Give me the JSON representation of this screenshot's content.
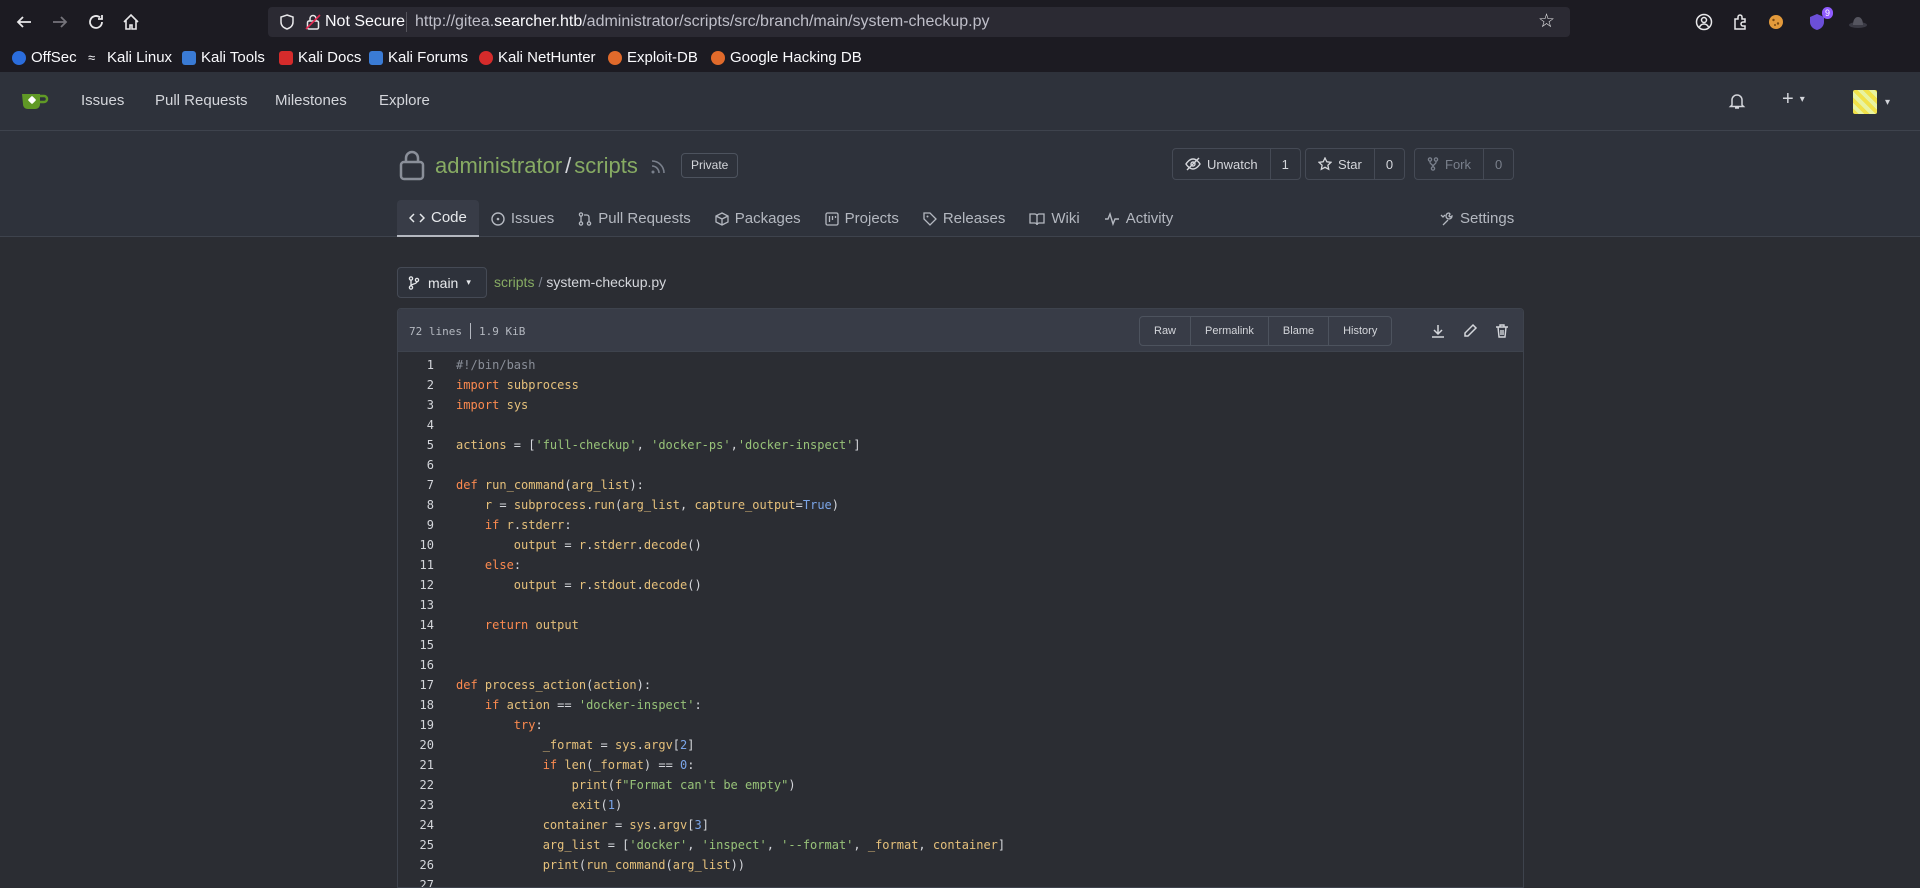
{
  "browser": {
    "url_security": "Not Secure",
    "url_prefix": "http://gitea.",
    "url_host": "searcher.htb",
    "url_path": "/administrator/scripts/src/branch/main/system-checkup.py",
    "extension_badge": "9",
    "bookmarks": [
      {
        "label": "OffSec",
        "color": "#2b6ddc"
      },
      {
        "label": "Kali Linux",
        "color": "#1c1b22"
      },
      {
        "label": "Kali Tools",
        "color": "#3a7bd5"
      },
      {
        "label": "Kali Docs",
        "color": "#d52b2b"
      },
      {
        "label": "Kali Forums",
        "color": "#3a7bd5"
      },
      {
        "label": "Kali NetHunter",
        "color": "#d52b2b"
      },
      {
        "label": "Exploit-DB",
        "color": "#e06a2b"
      },
      {
        "label": "Google Hacking DB",
        "color": "#e06a2b"
      }
    ]
  },
  "gitea": {
    "nav": [
      "Issues",
      "Pull Requests",
      "Milestones",
      "Explore"
    ],
    "repo": {
      "owner": "administrator",
      "name": "scripts",
      "visibility": "Private",
      "watch_label": "Unwatch",
      "watch_count": "1",
      "star_label": "Star",
      "star_count": "0",
      "fork_label": "Fork",
      "fork_count": "0"
    },
    "tabs": [
      "Code",
      "Issues",
      "Pull Requests",
      "Packages",
      "Projects",
      "Releases",
      "Wiki",
      "Activity"
    ],
    "settings_label": "Settings",
    "branch": "main",
    "breadcrumb_repo": "scripts",
    "breadcrumb_file": "system-checkup.py",
    "file": {
      "lines": "72 lines",
      "size": "1.9 KiB",
      "buttons": [
        "Raw",
        "Permalink",
        "Blame",
        "History"
      ]
    }
  },
  "code_lines": [
    "#!/bin/bash",
    "import subprocess",
    "import sys",
    "",
    "actions = ['full-checkup', 'docker-ps','docker-inspect']",
    "",
    "def run_command(arg_list):",
    "    r = subprocess.run(arg_list, capture_output=True)",
    "    if r.stderr:",
    "        output = r.stderr.decode()",
    "    else:",
    "        output = r.stdout.decode()",
    "",
    "    return output",
    "",
    "",
    "def process_action(action):",
    "    if action == 'docker-inspect':",
    "        try:",
    "            _format = sys.argv[2]",
    "            if len(_format) == 0:",
    "                print(f\"Format can't be empty\")",
    "                exit(1)",
    "            container = sys.argv[3]",
    "            arg_list = ['docker', 'inspect', '--format', _format, container]",
    "            print(run_command(arg_list))",
    ""
  ],
  "colors": {
    "keyword": "#fc8a4f",
    "string": "#98c379",
    "builtin": "#e5c07b",
    "number": "#7ba5e8",
    "comment": "#8a8f99",
    "accent": "#87ab63"
  }
}
